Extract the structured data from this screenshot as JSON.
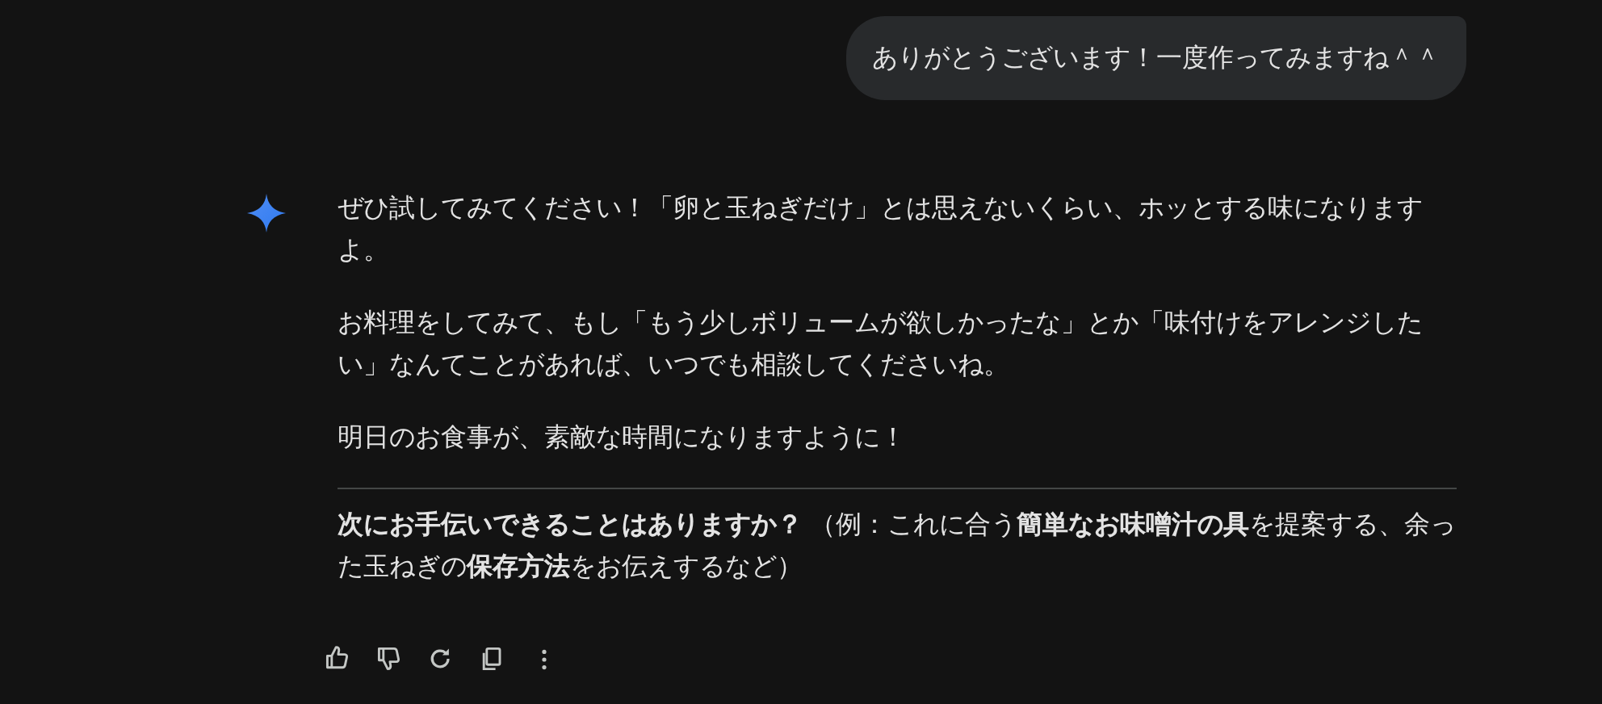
{
  "user_message": {
    "text": "ありがとうございます！一度作ってみますね＾＾"
  },
  "response": {
    "paragraphs": [
      "ぜひ試してみてください！「卵と玉ねぎだけ」とは思えないくらい、ホッとする味になりますよ。",
      "お料理をしてみて、もし「もう少しボリュームが欲しかったな」とか「味付けをアレンジしたい」なんてことがあれば、いつでも相談してくださいね。",
      "明日のお食事が、素敵な時間になりますように！"
    ],
    "follow_up": "**次にお手伝いできることはありますか？** （例：これに合う**簡単なお味噌汁の具**を提案する、余った玉ねぎの**保存方法**をお伝えするなど）"
  }
}
